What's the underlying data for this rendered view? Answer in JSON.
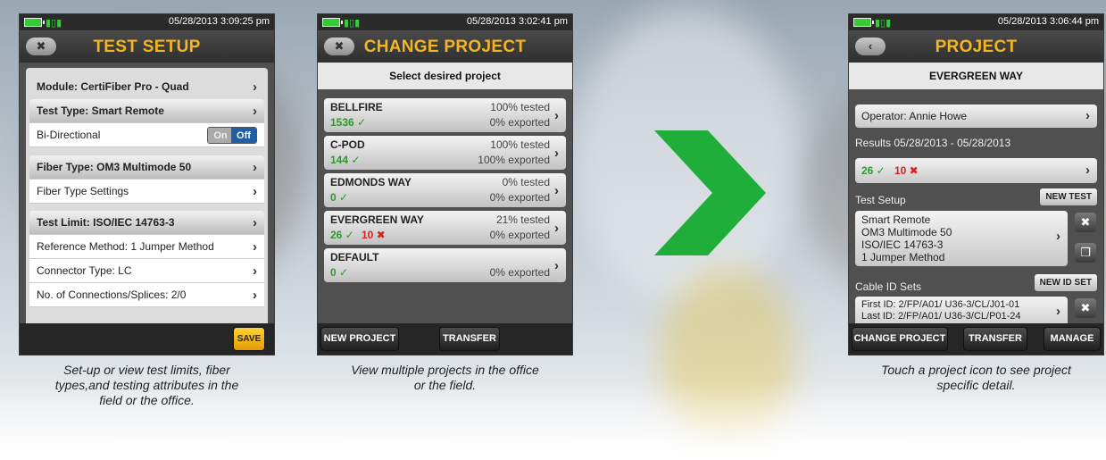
{
  "screen1": {
    "status_time": "05/28/2013 3:09:25 pm",
    "back_label": "✖",
    "title": "TEST SETUP",
    "module": "Module: CertiFiber Pro - Quad",
    "test_type": "Test Type: Smart Remote",
    "bidirectional": "Bi-Directional",
    "toggle_on": "On",
    "toggle_off": "Off",
    "fiber_type": "Fiber Type: OM3 Multimode 50",
    "fiber_settings": "Fiber Type Settings",
    "test_limit": "Test Limit: ISO/IEC 14763-3",
    "reference_method": "Reference Method: 1 Jumper Method",
    "connector_type": "Connector Type: LC",
    "connections": "No. of Connections/Splices: 2/0",
    "save_label": "SAVE",
    "caption_line1": "Set-up or view test limits, fiber",
    "caption_line2": "types,and testing attributes in the",
    "caption_line3": "field or the office."
  },
  "screen2": {
    "status_time": "05/28/2013 3:02:41 pm",
    "back_label": "✖",
    "title": "CHANGE PROJECT",
    "subtitle": "Select desired project",
    "projects": [
      {
        "name": "BELLFIRE",
        "pass": "1536 ✓",
        "fail": "",
        "tested": "100% tested",
        "exported": "0% exported"
      },
      {
        "name": "C-POD",
        "pass": "144 ✓",
        "fail": "",
        "tested": "100% tested",
        "exported": "100% exported"
      },
      {
        "name": "EDMONDS WAY",
        "pass": "0 ✓",
        "fail": "",
        "tested": "0% tested",
        "exported": "0% exported"
      },
      {
        "name": "EVERGREEN WAY",
        "pass": "26 ✓",
        "fail": "10 ✖",
        "tested": "21% tested",
        "exported": "0% exported"
      },
      {
        "name": "DEFAULT",
        "pass": "0 ✓",
        "fail": "",
        "tested": "",
        "exported": "0% exported"
      }
    ],
    "new_project_label": "NEW PROJECT",
    "transfer_label": "TRANSFER",
    "caption_line1": "View multiple projects in the office",
    "caption_line2": "or the field."
  },
  "screen3": {
    "status_time": "05/28/2013 3:06:44 pm",
    "back_label": "‹",
    "title": "PROJECT",
    "subtitle": "EVERGREEN WAY",
    "operator": "Operator: Annie Howe",
    "results_label": "Results 05/28/2013 - 05/28/2013",
    "results_pass": "26 ✓",
    "results_fail": "10 ✖",
    "test_setup_label": "Test Setup",
    "new_test_label": "NEW TEST",
    "setup_line1": "Smart Remote",
    "setup_line2": "OM3 Multimode 50",
    "setup_line3": "ISO/IEC 14763-3",
    "setup_line4": "1 Jumper Method",
    "cable_id_label": "Cable ID Sets",
    "new_id_set_label": "NEW ID SET",
    "first_id": "First ID: 2/FP/A01/ U36-3/CL/J01-01",
    "last_id": "Last ID: 2/FP/A01/ U36-3/CL/P01-24",
    "change_project_label": "CHANGE PROJECT",
    "transfer_label": "TRANSFER",
    "manage_label": "MANAGE",
    "caption_line1": "Touch a project icon to see project",
    "caption_line2": "specific detail."
  },
  "colors": {
    "title_accent": "#f3b522",
    "pass_green": "#2a9a2a",
    "fail_red": "#d42222",
    "arrow_green": "#1fae3a"
  }
}
